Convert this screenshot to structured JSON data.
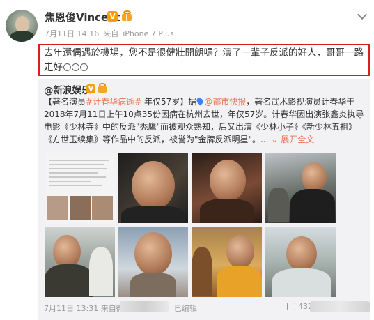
{
  "post": {
    "author_name": "焦恩俊Vincent",
    "verified_badge": "V",
    "timestamp": "7月11日 14:16",
    "source_prefix": "来自",
    "device": "iPhone 7 Plus",
    "text": "去年還偶遇於機場，您不是很健壯開朗嗎？演了一輩子反派的好人，哥哥一路走好",
    "emoji_icons": [
      "crying-emoji",
      "crying-emoji",
      "crying-emoji"
    ]
  },
  "repost": {
    "author": "@新浪娱乐",
    "verified_badge": "V",
    "text_1": "【著名演员",
    "hashtag": "#计春华病逝#",
    "text_2": " 年仅57岁】据",
    "location_link": "@都市快报",
    "text_3": "，著名武术影视演员计春华于2018年7月11日上午10点35份因病在杭州去世，年仅57岁。计春华因出演张鑫炎执导电影《少林寺》中的反派\"秃鹰\"而被观众熟知，后又出演《少林小子》《新少林五祖》《方世玉续集》等作品中的反派，被誉为\"金牌反派明星\"。",
    "ellipsis": "...",
    "expand_label": "展开全文",
    "expand_arrow": "chevron-down-icon",
    "timestamp": "7月11日 13:31",
    "source_prefix": "来自",
    "source_partial": "微",
    "edited_label": "已编辑",
    "share_count": "432"
  },
  "photos": [
    {
      "id": "photo-1"
    },
    {
      "id": "photo-2"
    },
    {
      "id": "photo-3"
    },
    {
      "id": "photo-4"
    },
    {
      "id": "photo-5"
    },
    {
      "id": "photo-6"
    },
    {
      "id": "photo-7"
    },
    {
      "id": "photo-8"
    }
  ],
  "colors": {
    "highlight_frame": "#d9201c",
    "link": "#eb7350",
    "badge": "#f59e0b",
    "repost_bg": "#f2f2f5"
  }
}
